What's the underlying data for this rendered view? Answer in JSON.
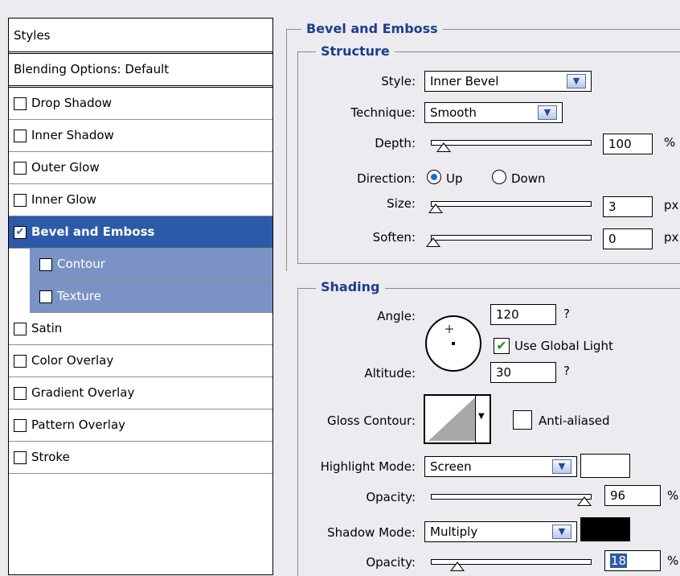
{
  "styles_list": {
    "header": "Styles",
    "blending": "Blending Options: Default",
    "items": [
      {
        "label": "Drop Shadow",
        "checked": false
      },
      {
        "label": "Inner Shadow",
        "checked": false
      },
      {
        "label": "Outer Glow",
        "checked": false
      },
      {
        "label": "Inner Glow",
        "checked": false
      },
      {
        "label": "Bevel and Emboss",
        "checked": true,
        "selected": true
      },
      {
        "label": "Contour",
        "checked": false,
        "sub": true
      },
      {
        "label": "Texture",
        "checked": false,
        "sub": true
      },
      {
        "label": "Satin",
        "checked": false
      },
      {
        "label": "Color Overlay",
        "checked": false
      },
      {
        "label": "Gradient Overlay",
        "checked": false
      },
      {
        "label": "Pattern Overlay",
        "checked": false
      },
      {
        "label": "Stroke",
        "checked": false
      }
    ]
  },
  "bevel": {
    "title": "Bevel and Emboss",
    "structure": {
      "title": "Structure",
      "style_label": "Style:",
      "style_value": "Inner Bevel",
      "technique_label": "Technique:",
      "technique_value": "Smooth",
      "depth_label": "Depth:",
      "depth_value": "100",
      "depth_unit": "%",
      "direction_label": "Direction:",
      "direction_up": "Up",
      "direction_down": "Down",
      "direction_selected": "Up",
      "size_label": "Size:",
      "size_value": "3",
      "size_unit": "px",
      "soften_label": "Soften:",
      "soften_value": "0",
      "soften_unit": "px"
    },
    "shading": {
      "title": "Shading",
      "angle_label": "Angle:",
      "angle_value": "120",
      "angle_unit": "?",
      "use_global_light_label": "Use Global Light",
      "use_global_light_checked": true,
      "altitude_label": "Altitude:",
      "altitude_value": "30",
      "altitude_unit": "?",
      "gloss_contour_label": "Gloss Contour:",
      "anti_aliased_label": "Anti-aliased",
      "anti_aliased_checked": false,
      "highlight_mode_label": "Highlight Mode:",
      "highlight_mode_value": "Screen",
      "highlight_color": "#ffffff",
      "highlight_opacity_label": "Opacity:",
      "highlight_opacity_value": "96",
      "highlight_opacity_unit": "%",
      "shadow_mode_label": "Shadow Mode:",
      "shadow_mode_value": "Multiply",
      "shadow_color": "#000000",
      "shadow_opacity_label": "Opacity:",
      "shadow_opacity_value": "18",
      "shadow_opacity_unit": "%"
    }
  }
}
